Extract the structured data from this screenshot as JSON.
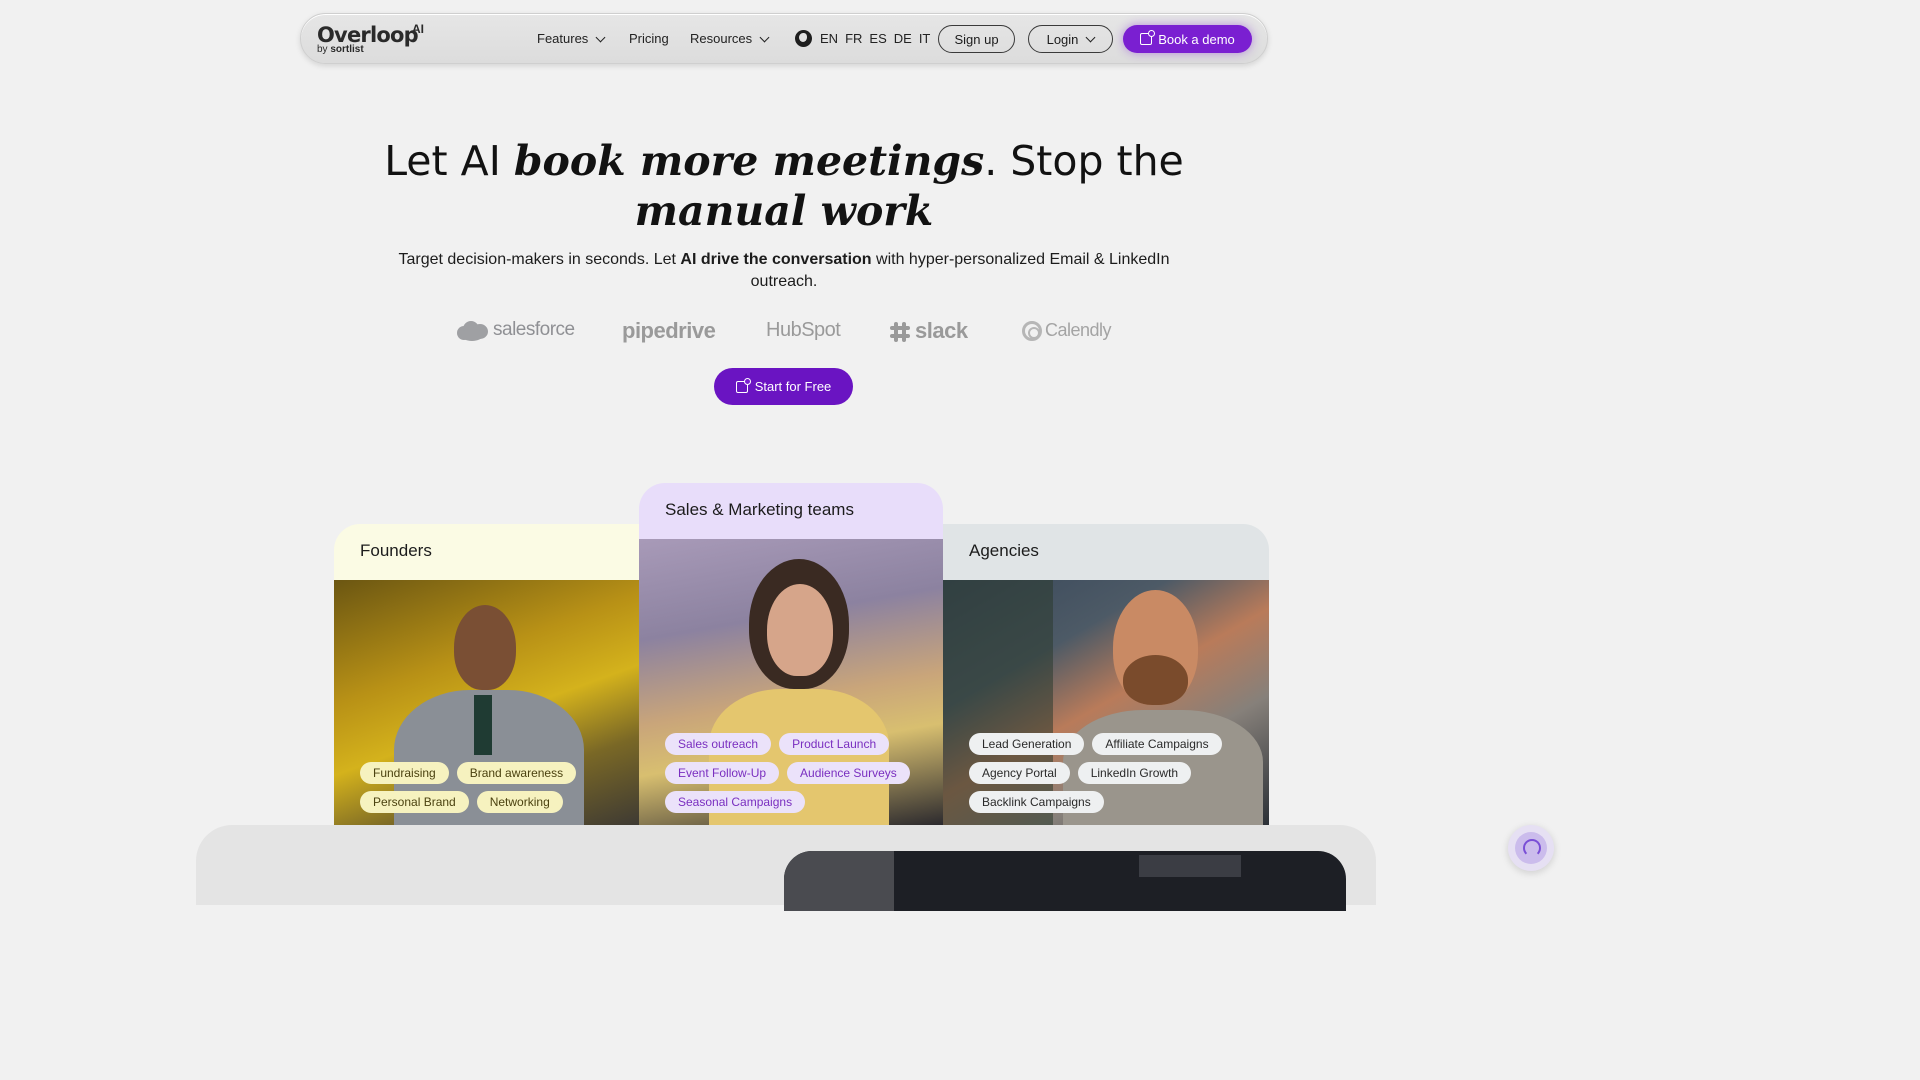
{
  "nav": {
    "logo": "Overloop",
    "logo_suffix": "AI",
    "logo_by": "by",
    "logo_by_brand": "sortlist",
    "links": [
      {
        "label": "Features",
        "has_dropdown": true
      },
      {
        "label": "Pricing",
        "has_dropdown": false
      },
      {
        "label": "Resources",
        "has_dropdown": true
      }
    ],
    "languages": [
      "EN",
      "FR",
      "ES",
      "DE",
      "IT"
    ],
    "signup_label": "Sign up",
    "login_label": "Login",
    "demo_label": "Book a demo"
  },
  "hero": {
    "title_part1": "Let AI ",
    "title_emph1": "book more meetings",
    "title_part2": ". Stop the",
    "title_emph2": "manual work",
    "subtitle_part1": "Target decision-makers in seconds. Let ",
    "subtitle_bold": "AI drive the conversation",
    "subtitle_part2": " with hyper-personalized Email & LinkedIn outreach.",
    "integrations": [
      "salesforce",
      "pipedrive",
      "HubSpot",
      "slack",
      "Calendly"
    ],
    "cta_label": "Start for Free"
  },
  "cards": [
    {
      "title": "Founders",
      "chips": [
        "Fundraising",
        "Brand awareness",
        "Personal Brand",
        "Networking"
      ]
    },
    {
      "title": "Sales & Marketing teams",
      "chips": [
        "Sales outreach",
        "Product Launch",
        "Event Follow-Up",
        "Audience Surveys",
        "Seasonal Campaigns"
      ]
    },
    {
      "title": "Agencies",
      "chips": [
        "Lead Generation",
        "Affiliate Campaigns",
        "Agency Portal",
        "LinkedIn Growth",
        "Backlink Campaigns"
      ]
    }
  ],
  "colors": {
    "accent": "#7a1fd1",
    "cta": "#6a14c2",
    "founders_tab": "#fbfbe4",
    "sales_tab": "#e8ddfa",
    "agencies_tab": "#e0e4e6"
  },
  "icons": [
    "chevron-down-icon",
    "globe-icon",
    "calendar-icon",
    "support-headset-icon"
  ]
}
